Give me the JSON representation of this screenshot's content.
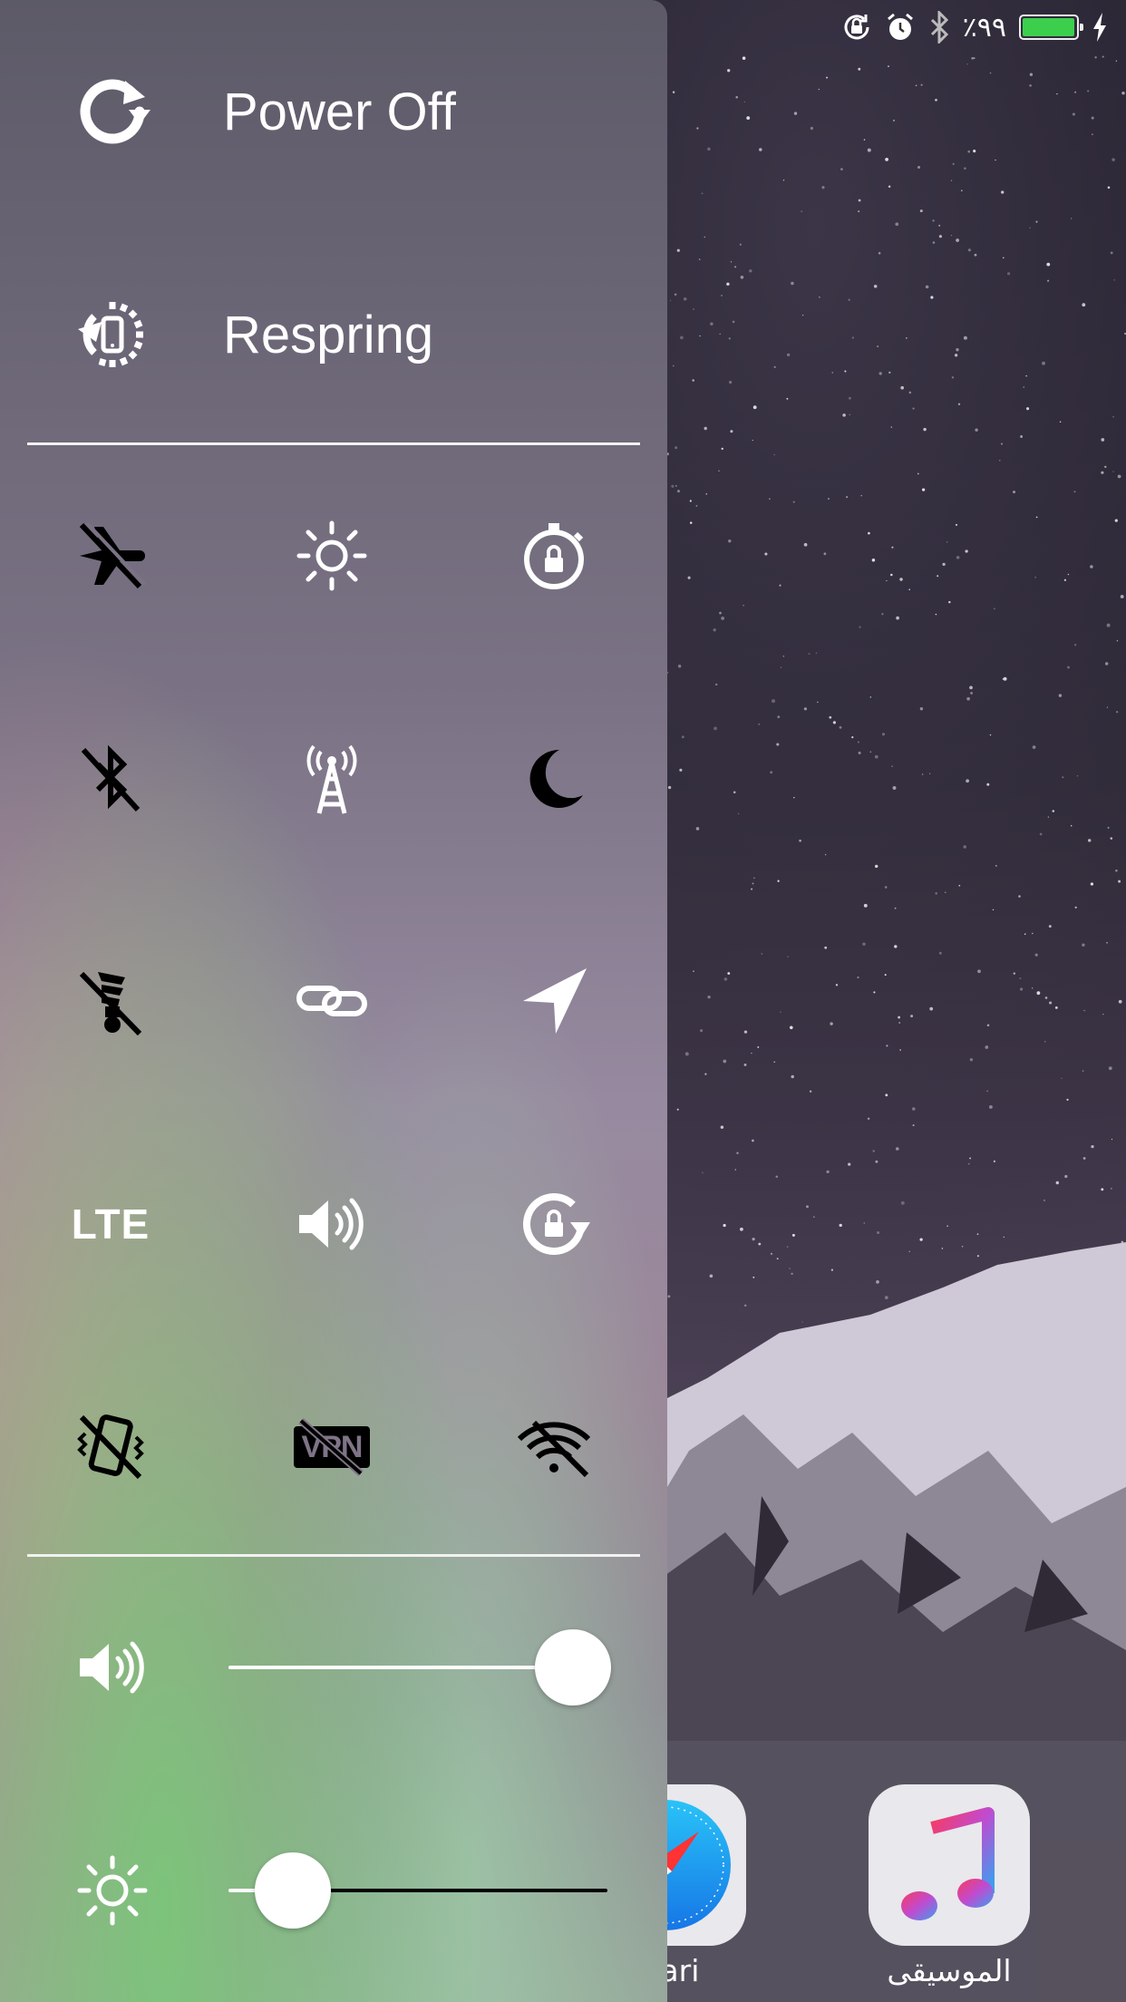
{
  "status_bar": {
    "rotation_lock_icon": "rotation-lock-icon",
    "alarm_icon": "alarm-icon",
    "bluetooth_icon": "bluetooth-icon",
    "battery_text": "٪٩٩",
    "battery_level": 0.99,
    "battery_color": "#3ccf4e",
    "charging_icon": "bolt-icon"
  },
  "panel": {
    "menu": [
      {
        "label": "Power Off",
        "icon": "reboot-icon"
      },
      {
        "label": "Respring",
        "icon": "respring-icon"
      }
    ],
    "toggles": [
      {
        "icon": "airplane-mode-off-icon",
        "state": "off"
      },
      {
        "icon": "brightness-icon",
        "state": "on"
      },
      {
        "icon": "auto-lock-timer-icon",
        "state": "on"
      },
      {
        "icon": "bluetooth-off-icon",
        "state": "off"
      },
      {
        "icon": "cellular-data-icon",
        "state": "on"
      },
      {
        "icon": "do-not-disturb-icon",
        "state": "off"
      },
      {
        "icon": "flashlight-off-icon",
        "state": "off"
      },
      {
        "icon": "link-icon",
        "state": "on"
      },
      {
        "icon": "location-icon",
        "state": "on"
      },
      {
        "label": "LTE",
        "icon": "lte-icon",
        "state": "on"
      },
      {
        "icon": "ringer-icon",
        "state": "on"
      },
      {
        "icon": "rotation-lock-icon",
        "state": "on"
      },
      {
        "icon": "vibration-off-icon",
        "state": "off"
      },
      {
        "label": "VPN",
        "icon": "vpn-off-icon",
        "state": "off"
      },
      {
        "icon": "wifi-off-icon",
        "state": "off"
      }
    ],
    "sliders": [
      {
        "icon": "volume-icon",
        "value": 0.91
      },
      {
        "icon": "brightness-icon",
        "value": 0.17
      }
    ]
  },
  "dock": {
    "apps": [
      {
        "label": "afari",
        "icon": "safari-icon"
      },
      {
        "label": "الموسيقى",
        "icon": "music-icon"
      }
    ]
  }
}
